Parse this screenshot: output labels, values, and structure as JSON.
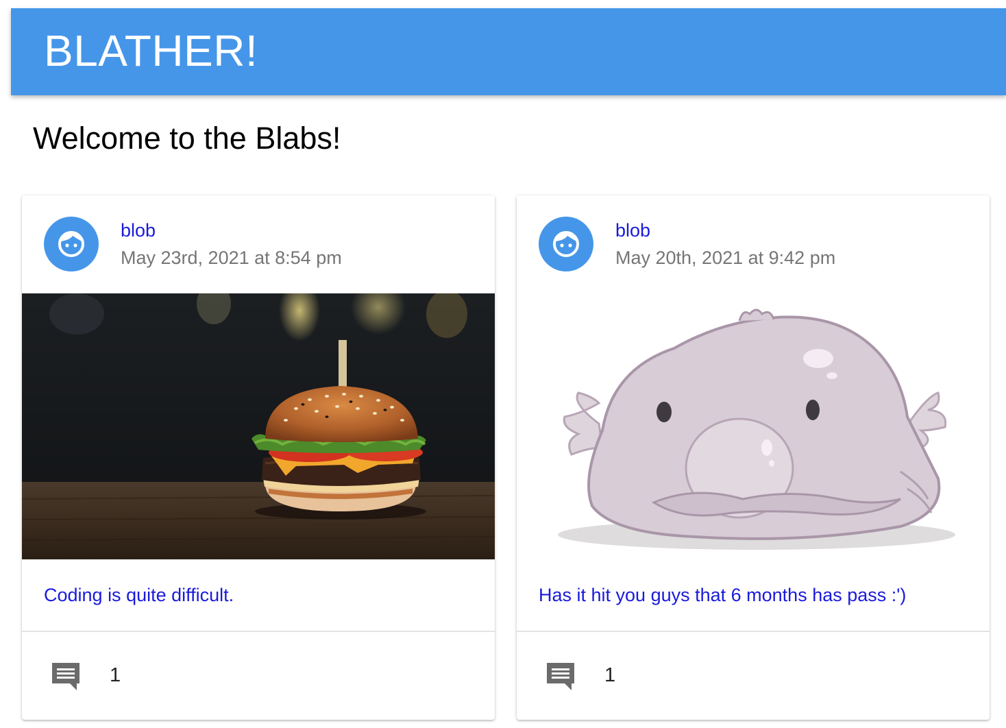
{
  "app": {
    "title": "BLATHER!"
  },
  "page": {
    "heading": "Welcome to the Blabs!"
  },
  "colors": {
    "appbar": "#4596e9",
    "link": "#1a1adc",
    "date": "#757575"
  },
  "posts": [
    {
      "author": "blob",
      "date": "May 23rd, 2021 at 8:54 pm",
      "avatar_icon": "face-icon",
      "image": "burger-photo",
      "text": "Coding is quite difficult.",
      "comment_icon": "comment-icon",
      "comment_count": "1"
    },
    {
      "author": "blob",
      "date": "May 20th, 2021 at 9:42 pm",
      "avatar_icon": "face-icon",
      "image": "blobfish-illustration",
      "text": "Has it hit you guys that 6 months has pass :')",
      "comment_icon": "comment-icon",
      "comment_count": "1"
    }
  ]
}
